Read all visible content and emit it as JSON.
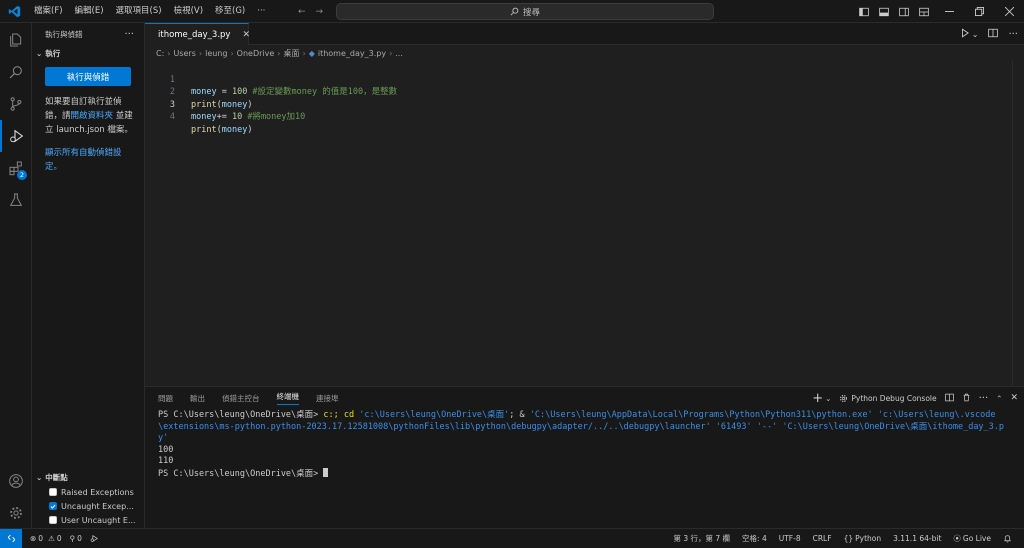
{
  "titlebar": {
    "menu": [
      "檔案(F)",
      "編輯(E)",
      "選取項目(S)",
      "檢視(V)",
      "移至(G)",
      "···"
    ],
    "search_placeholder": "搜尋",
    "window_controls": [
      "minimize-icon",
      "maximize-icon",
      "close-icon"
    ]
  },
  "sidebar": {
    "header_title": "執行與偵錯",
    "header_more": "···",
    "run_section_title": "執行",
    "run_button_label": "執行與偵錯",
    "info_text_1": "如果要自訂執行並偵錯，請",
    "info_link_open_folder": "開啟資料夾",
    "info_text_2": " 並建立 launch.json 檔案。",
    "show_auto_debug_link": "顯示所有自動偵錯設定。",
    "breakpoints_title": "中斷點",
    "breakpoints": [
      {
        "label": "Raised Exceptions",
        "checked": false
      },
      {
        "label": "Uncaught Excep...",
        "checked": true
      },
      {
        "label": "User Uncaught E...",
        "checked": false
      }
    ]
  },
  "editor": {
    "tab_label": "ithome_day_3.py",
    "tab_close": "✕",
    "breadcrumb": [
      "C:",
      "Users",
      "leung",
      "OneDrive",
      "桌面",
      "ithome_day_3.py",
      "..."
    ],
    "lines": [
      {
        "num": "1",
        "var": "money",
        "op": " = ",
        "num_lit": "100",
        "comment": " #設定變數money 的值是100，是整數"
      },
      {
        "num": "2",
        "fn": "print",
        "arg": "money"
      },
      {
        "num": "3",
        "var": "money",
        "op": "+= ",
        "num_lit": "10",
        "comment": " #將money加10"
      },
      {
        "num": "4",
        "fn": "print",
        "arg": "money"
      }
    ]
  },
  "panel": {
    "tabs": [
      "問題",
      "輸出",
      "偵錯主控台",
      "終端機",
      "連接埠"
    ],
    "active_tab": "終端機",
    "debug_console_label": "Python Debug Console",
    "add_label": "+",
    "terminal": {
      "prompt": "PS C:\\Users\\leung\\OneDrive\\桌面> ",
      "cmd_part1": "c:; cd ",
      "cmd_str1": "'c:\\Users\\leung\\OneDrive\\桌面'",
      "cmd_part2": "; & ",
      "cmd_str2": "'C:\\Users\\leung\\AppData\\Local\\Programs\\Python\\Python311\\python.exe' 'c:\\Users\\leung\\.vscode",
      "line2": "\\extensions\\ms-python.python-2023.17.12581008\\pythonFiles\\lib\\python\\debugpy\\adapter/../..\\debugpy\\launcher' '61493' '--' 'C:\\Users\\leung\\OneDrive\\桌面\\ithome_day_3.p",
      "line3": "y'",
      "output1": "100",
      "output2": "110",
      "final_prompt": "PS C:\\Users\\leung\\OneDrive\\桌面> "
    }
  },
  "statusbar": {
    "errors": "0",
    "warnings": "0",
    "ports": "0",
    "position": "第 3 行，第 7 欄",
    "spaces": "空格: 4",
    "encoding": "UTF-8",
    "eol": "CRLF",
    "language": "Python",
    "interpreter": "3.11.1 64-bit",
    "go_live": "Go Live"
  },
  "colors": {
    "accent": "#0078d4",
    "link": "#4daafc",
    "comment": "#6a9955",
    "number": "#b5cea8",
    "variable": "#9cdcfe",
    "function": "#dcdcaa"
  }
}
